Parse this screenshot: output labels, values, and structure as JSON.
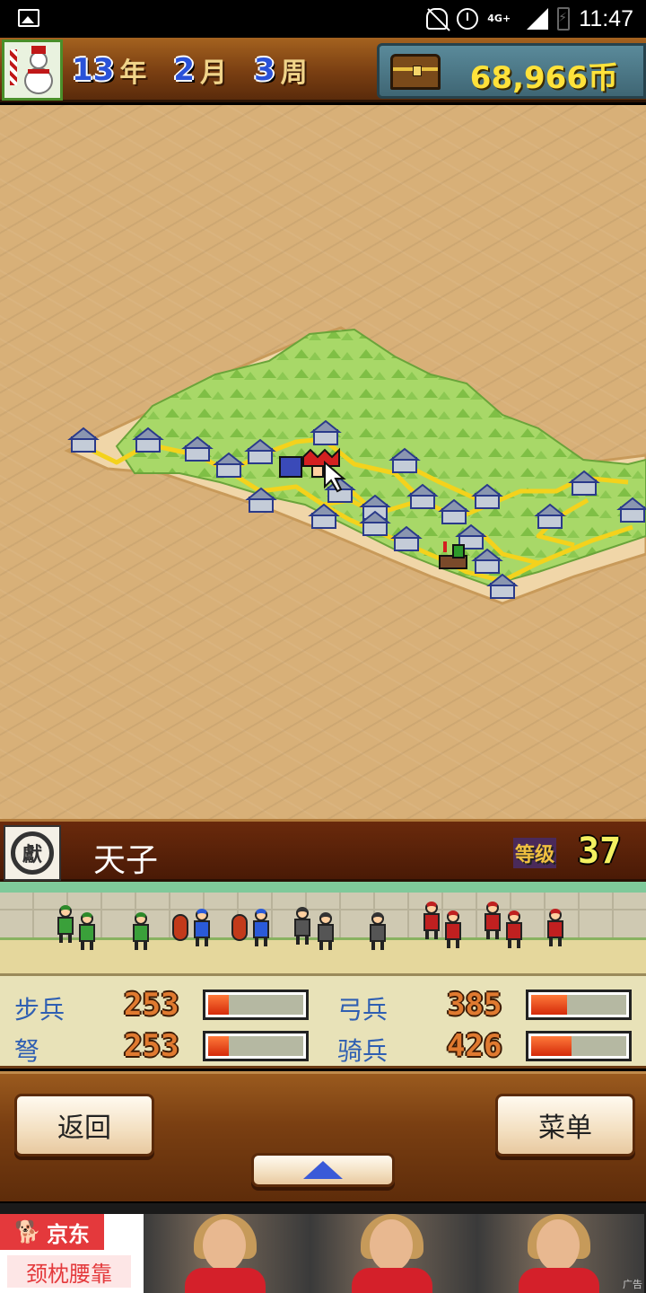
{
  "status_bar": {
    "time": "11:47",
    "network": "4G+",
    "icons": [
      "gallery-icon",
      "mute-icon",
      "alarm-icon",
      "signal-icon",
      "battery-charging-icon"
    ]
  },
  "hud": {
    "year": "13",
    "year_unit": "年",
    "month": "2",
    "month_unit": "月",
    "week": "3",
    "week_unit": "周",
    "money": "68,966币"
  },
  "info": {
    "emblem_char": "獻",
    "ruler_name": "天子",
    "level_label": "等级",
    "level_value": "37"
  },
  "stats": [
    {
      "name": "步兵",
      "value": "253",
      "fill": 0.22
    },
    {
      "name": "弓兵",
      "value": "385",
      "fill": 0.38
    },
    {
      "name": "弩",
      "value": "253",
      "fill": 0.22
    },
    {
      "name": "骑兵",
      "value": "426",
      "fill": 0.42
    }
  ],
  "controls": {
    "back_label": "返回",
    "menu_label": "菜单",
    "up_icon": "up-arrow-icon"
  },
  "ad": {
    "brand": "京东",
    "tagline": "颈枕腰靠",
    "label": "广告"
  },
  "colors": {
    "sand": "#d8b078",
    "grass": "#9ed060",
    "road": "#f4d21c",
    "money": "#ffe23a",
    "stat_name": "#2f5fb2"
  }
}
